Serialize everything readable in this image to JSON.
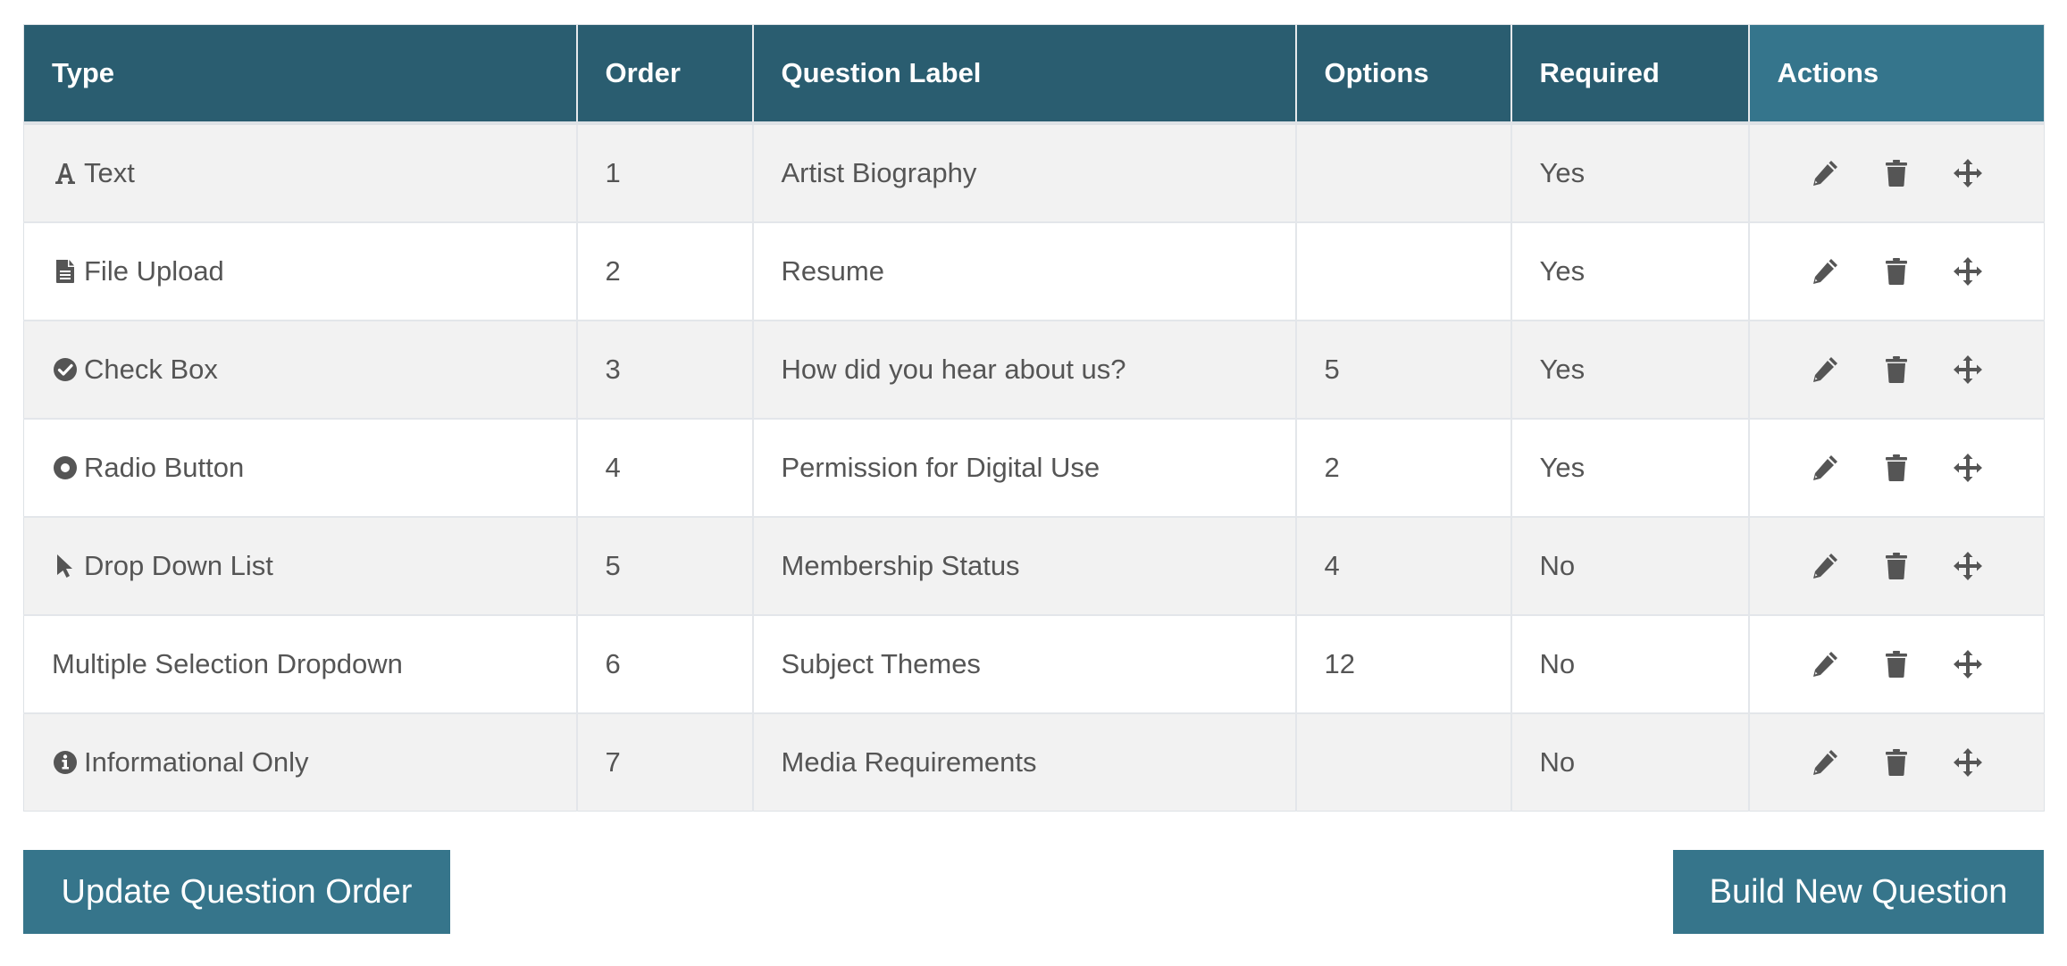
{
  "table": {
    "headers": {
      "type": "Type",
      "order": "Order",
      "label": "Question Label",
      "options": "Options",
      "required": "Required",
      "actions": "Actions"
    },
    "rows": [
      {
        "type": "Text",
        "type_icon": "font-icon",
        "order": "1",
        "label": "Artist Biography",
        "options": "",
        "required": "Yes"
      },
      {
        "type": "File Upload",
        "type_icon": "file-icon",
        "order": "2",
        "label": "Resume",
        "options": "",
        "required": "Yes"
      },
      {
        "type": "Check Box",
        "type_icon": "check-circle-icon",
        "order": "3",
        "label": "How did you hear about us?",
        "options": "5",
        "required": "Yes"
      },
      {
        "type": "Radio Button",
        "type_icon": "dot-circle-icon",
        "order": "4",
        "label": "Permission for Digital Use",
        "options": "2",
        "required": "Yes"
      },
      {
        "type": "Drop Down List",
        "type_icon": "mouse-pointer-icon",
        "order": "5",
        "label": "Membership Status",
        "options": "4",
        "required": "No"
      },
      {
        "type": "Multiple Selection Dropdown",
        "type_icon": "",
        "order": "6",
        "label": "Subject Themes",
        "options": "12",
        "required": "No"
      },
      {
        "type": "Informational Only",
        "type_icon": "info-circle-icon",
        "order": "7",
        "label": "Media Requirements",
        "options": "",
        "required": "No"
      }
    ],
    "row_actions": [
      "pencil-icon",
      "trash-icon",
      "move-icon"
    ]
  },
  "buttons": {
    "update_order": "Update Question Order",
    "build_new": "Build New Question"
  },
  "colors": {
    "header": "#2a5d70",
    "header_actions": "#35758c",
    "button": "#36758b",
    "text": "#555555",
    "row_alt": "#f2f2f2"
  }
}
